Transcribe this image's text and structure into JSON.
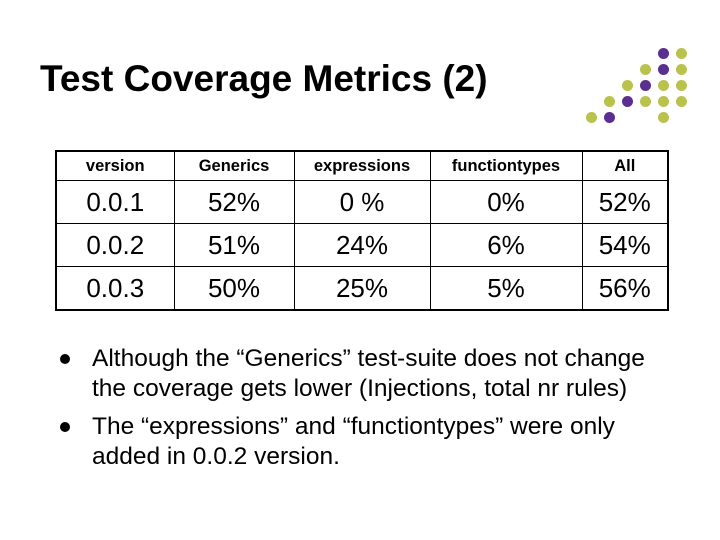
{
  "title": "Test Coverage Metrics (2)",
  "chart_data": {
    "type": "table",
    "columns": [
      "version",
      "Generics",
      "expressions",
      "functiontypes",
      "All"
    ],
    "rows": [
      {
        "version": "0.0.1",
        "Generics": "52%",
        "expressions": "0 %",
        "functiontypes": "0%",
        "All": "52%"
      },
      {
        "version": "0.0.2",
        "Generics": "51%",
        "expressions": "24%",
        "functiontypes": "6%",
        "All": "54%"
      },
      {
        "version": "0.0.3",
        "Generics": "50%",
        "expressions": "25%",
        "functiontypes": "5%",
        "All": "56%"
      }
    ]
  },
  "bullets": [
    "Although the “Generics” test-suite does not change the coverage gets lower (Injections, total nr rules)",
    "The “expressions” and “functiontypes” were only added in 0.0.2 version."
  ],
  "decor_colors": {
    "purple": "#5b2e91",
    "olive": "#b9c24a"
  }
}
